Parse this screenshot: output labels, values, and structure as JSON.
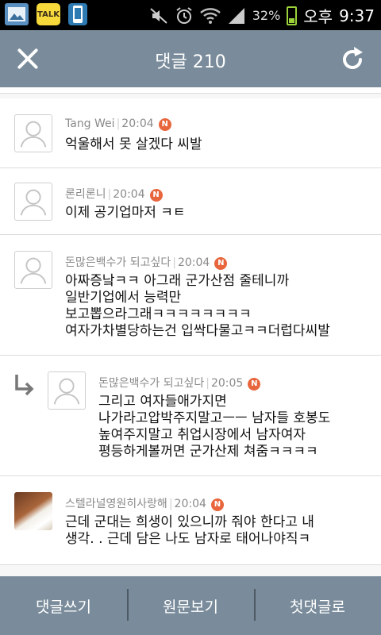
{
  "status_bar": {
    "icons_left": [
      "gallery-icon",
      "kakaotalk-icon",
      "phone-icon"
    ],
    "talk_label": "TALK",
    "battery": "32%",
    "ampm": "오후",
    "time": "9:37"
  },
  "header": {
    "title": "댓글 210",
    "close_icon": "close-icon",
    "refresh_icon": "refresh-icon"
  },
  "comments": [
    {
      "author": "Tang Wei",
      "time": "20:04",
      "badge": "N",
      "text": "억울해서 못 살겠다 씨발"
    },
    {
      "author": "론리론니",
      "time": "20:04",
      "badge": "N",
      "text": "이제 공기업마저 ㅋㅌ"
    },
    {
      "author": "돈많은백수가 되고싶다",
      "time": "20:04",
      "badge": "N",
      "text": "아짜증낰ㅋㅋ 아그래 군가산점 줄테니까\n일반기업에서 능력만\n보고뽑으라그래ㅋㅋㅋㅋㅋㅋㅋㅋ\n여자가차별당하는건 입싹다물고ㅋㅋ더럽다씨발"
    },
    {
      "author": "돈많은백수가 되고싶다",
      "time": "20:05",
      "badge": "N",
      "text": "그리고 여자들애가지면\n나가라고압박주지말고ㅡㅡ 남자들 호봉도\n높여주지말고 취업시장에서 남자여자\n평등하게볼꺼면 군가산제 쳐줌ㅋㅋㅋㅋ",
      "reply": true
    },
    {
      "author": "스텔라널영원히사랑해",
      "time": "20:04",
      "badge": "N",
      "text": "근데 군대는 희생이 있으니까 줘야 한다고 내\n생각. . 근데 담은 나도 남자로 태어나야직ㅋ",
      "photo": true
    }
  ],
  "bottom_bar": {
    "write": "댓글쓰기",
    "original": "원문보기",
    "first": "첫댓글로"
  },
  "colors": {
    "header": "#7a8c9b",
    "badge": "#e8663d",
    "battery": "#9bd23a"
  }
}
